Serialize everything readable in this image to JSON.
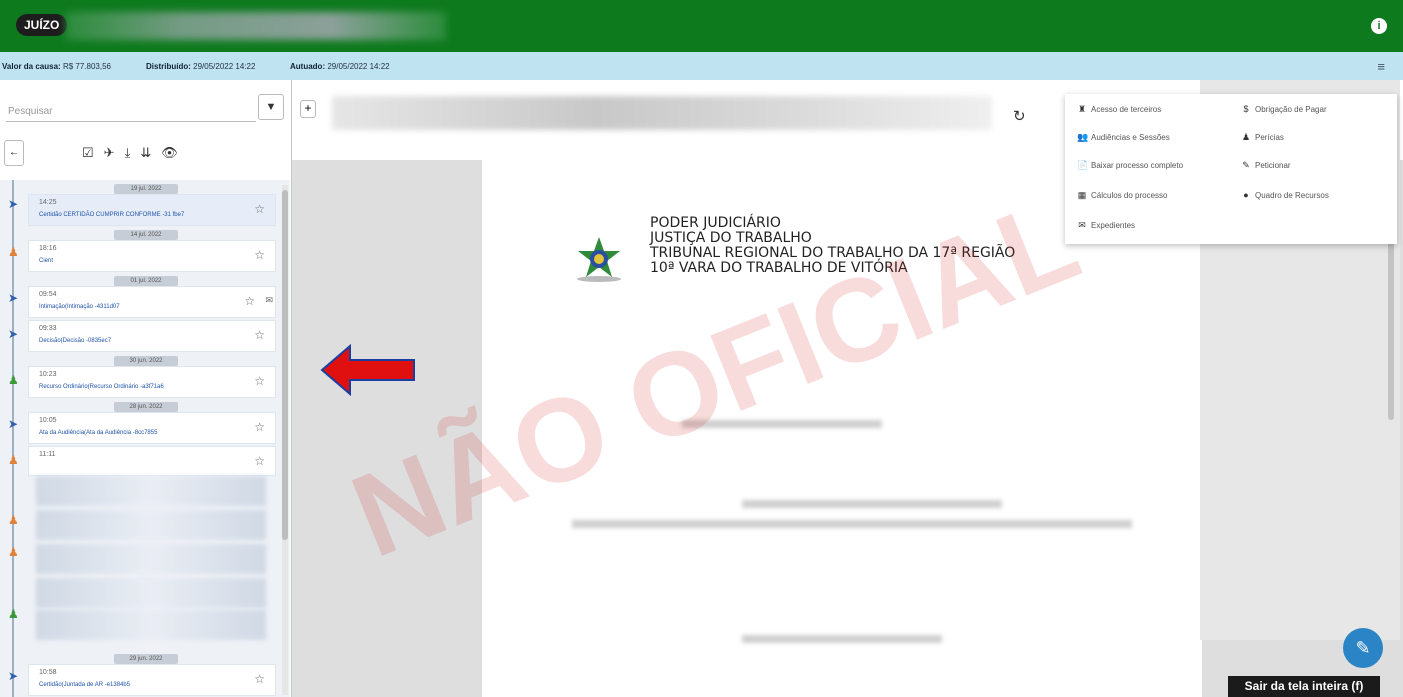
{
  "topbar": {
    "badge": "JUÍZO",
    "info_icon": "i"
  },
  "infobar": {
    "valor_label": "Valor da causa:",
    "valor_value": "R$ 77.803,56",
    "distrib_label": "Distribuído:",
    "distrib_value": "29/05/2022 14:22",
    "autuado_label": "Autuado:",
    "autuado_value": "29/05/2022 14:22"
  },
  "sidebar": {
    "search_placeholder": "Pesquisar",
    "filter_icon": "filter-icon",
    "back_icon": "arrow-left-icon",
    "tool_icons": [
      "☑",
      "✈",
      "⤓",
      "⇊",
      "👁"
    ],
    "timeline": [
      {
        "day": "19 jul. 2022",
        "time": "14:25",
        "doc": "Certidão CERTIDÃO CUMPRIR CONFORME -31 fbe7",
        "pin": "#2f5fb0"
      },
      {
        "day": "14 jul. 2022",
        "time": "18:16",
        "doc": "Cient",
        "pin": "#e0823a"
      },
      {
        "day": "01 jul. 2022",
        "time": "09:54",
        "doc": "Intimação(Intimação -4311d07",
        "pin": "#2f5fb0"
      },
      {
        "day": "",
        "time": "09:33",
        "doc": "Decisão(Decisão -0835ec7",
        "pin": "#2f5fb0"
      },
      {
        "day": "30 jun. 2022",
        "time": "10:23",
        "doc": "Recurso Ordinário(Recurso Ordinário -a3f71a6",
        "pin": "#3a9a3a"
      },
      {
        "day": "28 jun. 2022",
        "time": "10:05",
        "doc": "Ata da Audiência(Ata da Audiência -8cc7855",
        "pin": "#2f5fb0"
      },
      {
        "day": "",
        "time": "11:11",
        "doc": "",
        "pin": "#e0823a"
      }
    ],
    "last_item": {
      "day": "29 jun. 2022",
      "time": "10:58",
      "doc": "Certidão(Juntada de AR -e1384b5"
    }
  },
  "document": {
    "header_lines": [
      "PODER JUDICIÁRIO",
      "JUSTIÇA DO TRABALHO",
      "TRIBUNAL REGIONAL DO TRABALHO DA 17ª REGIÃO",
      "10ª VARA DO TRABALHO DE VITÓRIA"
    ],
    "watermark": "NÃO OFICIAL"
  },
  "menu": {
    "left": [
      {
        "icon": "♜",
        "label": "Acesso de terceiros"
      },
      {
        "icon": "👥",
        "label": "Audiências e Sessões"
      },
      {
        "icon": "📄",
        "label": "Baixar processo completo"
      },
      {
        "icon": "▦",
        "label": "Cálculos do processo"
      },
      {
        "icon": "✉",
        "label": "Expedientes"
      }
    ],
    "right": [
      {
        "icon": "$",
        "label": "Obrigação de Pagar"
      },
      {
        "icon": "♟",
        "label": "Perícias"
      },
      {
        "icon": "✎",
        "label": "Peticionar"
      },
      {
        "icon": "●",
        "label": "Quadro de Recursos"
      }
    ]
  },
  "fab_icon": "✎",
  "tooltip": "Sair da tela inteira (f)",
  "colors": {
    "topbar": "#0e7a1e",
    "infobar": "#bfe3f1",
    "arrow": "#e01010",
    "fab": "#2b84c6"
  }
}
